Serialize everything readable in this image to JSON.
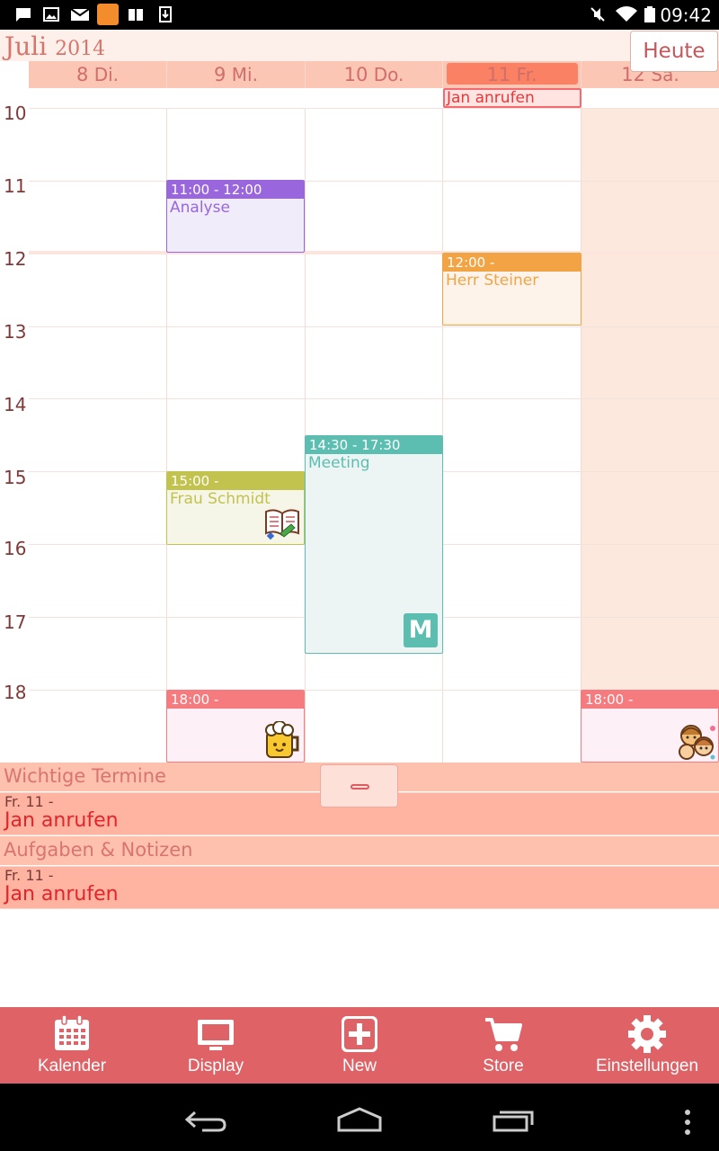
{
  "status_bar": {
    "time": "09:42",
    "left_icons": [
      "message-icon",
      "image-icon",
      "mail-icon",
      "rss-icon",
      "book-icon",
      "download-icon"
    ],
    "right_icons": [
      "mute-icon",
      "wifi-icon",
      "battery-icon"
    ]
  },
  "header": {
    "month": "Juli",
    "year": "2014",
    "today_label": "Heute"
  },
  "days": [
    {
      "num": "8",
      "name": "Di."
    },
    {
      "num": "9",
      "name": "Mi."
    },
    {
      "num": "10",
      "name": "Do."
    },
    {
      "num": "11",
      "name": "Fr.",
      "selected": true
    },
    {
      "num": "12",
      "name": "Sa."
    }
  ],
  "allday_event": {
    "title": "Jan anrufen"
  },
  "hours": [
    "10",
    "11",
    "12",
    "13",
    "14",
    "15",
    "16",
    "17",
    "18"
  ],
  "events": [
    {
      "time": "11:00 - 12:00",
      "title": "Analyse",
      "color": "#9966dd"
    },
    {
      "time": "12:00 -",
      "title": "Herr Steiner",
      "color": "#f2a444"
    },
    {
      "time": "14:30 - 17:30",
      "title": "Meeting",
      "color": "#5cbdb1",
      "badge": "M"
    },
    {
      "time": "15:00 -",
      "title": "Frau Schmidt",
      "color": "#c2c24e",
      "icon": "book-icon"
    },
    {
      "time": "18:00 -",
      "title": "",
      "color": "#f57b7f",
      "icon": "beer-icon"
    },
    {
      "time": "18:00 -",
      "title": "",
      "color": "#f57b7f",
      "icon": "family-icon"
    }
  ],
  "important": {
    "heading": "Wichtige Termine",
    "items": [
      {
        "date": "Fr. 11 -",
        "title": "Jan anrufen"
      }
    ]
  },
  "tasks": {
    "heading": "Aufgaben & Notizen",
    "items": [
      {
        "date": "Fr. 11 -",
        "title": "Jan anrufen"
      }
    ]
  },
  "toolbar": {
    "items": [
      {
        "label": "Kalender",
        "icon": "calendar-icon"
      },
      {
        "label": "Display",
        "icon": "monitor-icon"
      },
      {
        "label": "New",
        "icon": "plus-icon"
      },
      {
        "label": "Store",
        "icon": "cart-icon"
      },
      {
        "label": "Einstellungen",
        "icon": "gear-icon"
      }
    ]
  },
  "nav_bar": [
    "back-icon",
    "home-icon",
    "recents-icon",
    "menu-icon"
  ],
  "colors": {
    "accent": "#de6266",
    "header_bg": "#fdf0ea",
    "dayhead_bg": "#fbc6b4",
    "selected_day": "#fa8164"
  }
}
